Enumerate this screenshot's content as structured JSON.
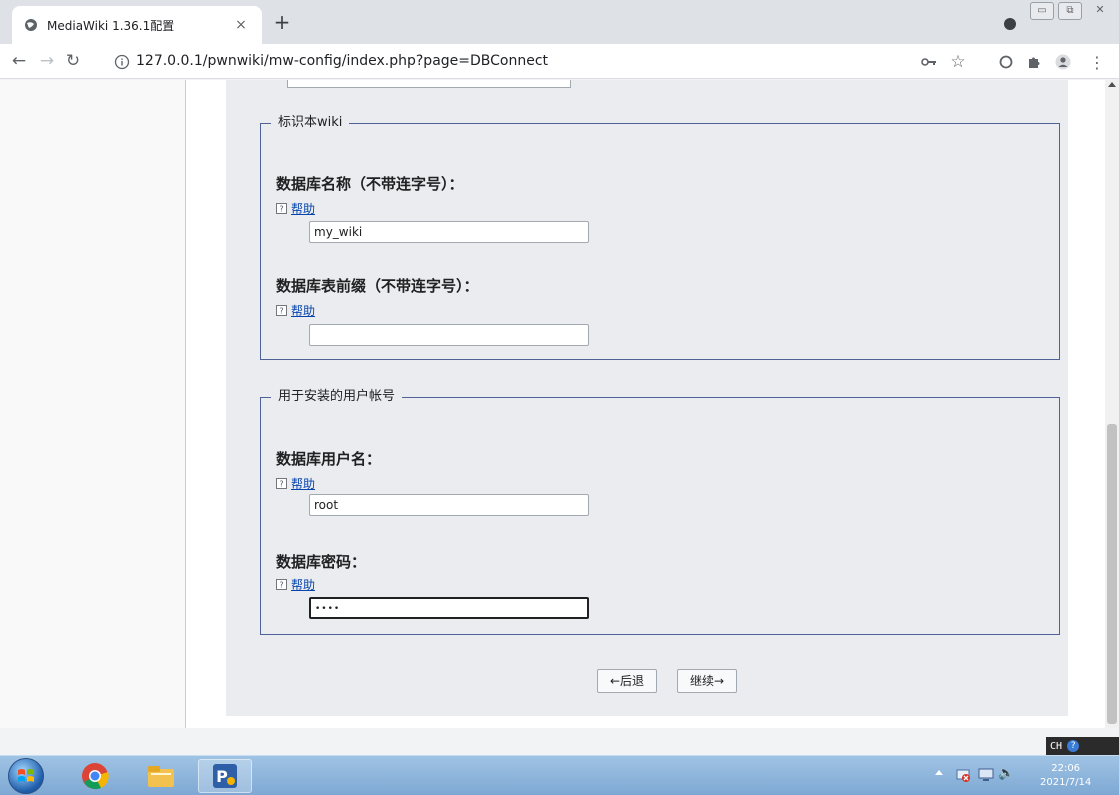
{
  "browser": {
    "tab_title": "MediaWiki 1.36.1配置",
    "tab_close": "×",
    "new_tab": "+",
    "url": "127.0.0.1/pwnwiki/mw-config/index.php?page=DBConnect",
    "win_min": "▭",
    "win_max": "⧉",
    "win_close": "✕"
  },
  "sections": [
    {
      "legend": "标识本wiki",
      "fields": [
        {
          "label": "数据库名称（不带连字号）：",
          "help": "帮助",
          "value": "my_wiki"
        },
        {
          "label": "数据库表前缀（不带连字号）：",
          "help": "帮助",
          "value": ""
        }
      ]
    },
    {
      "legend": "用于安装的用户帐号",
      "fields": [
        {
          "label": "数据库用户名：",
          "help": "帮助",
          "value": "root"
        },
        {
          "label": "数据库密码：",
          "help": "帮助",
          "value": "••••"
        }
      ]
    }
  ],
  "buttons": {
    "back": "←后退",
    "continue": "继续→"
  },
  "ime": {
    "lang": "CH",
    "help": "?"
  },
  "clock": {
    "time": "22:06",
    "date": "2021/7/14"
  },
  "colors": {
    "link": "#0645ad",
    "fieldset_border": "#4f6196",
    "panel_bg": "#eaecf0"
  }
}
